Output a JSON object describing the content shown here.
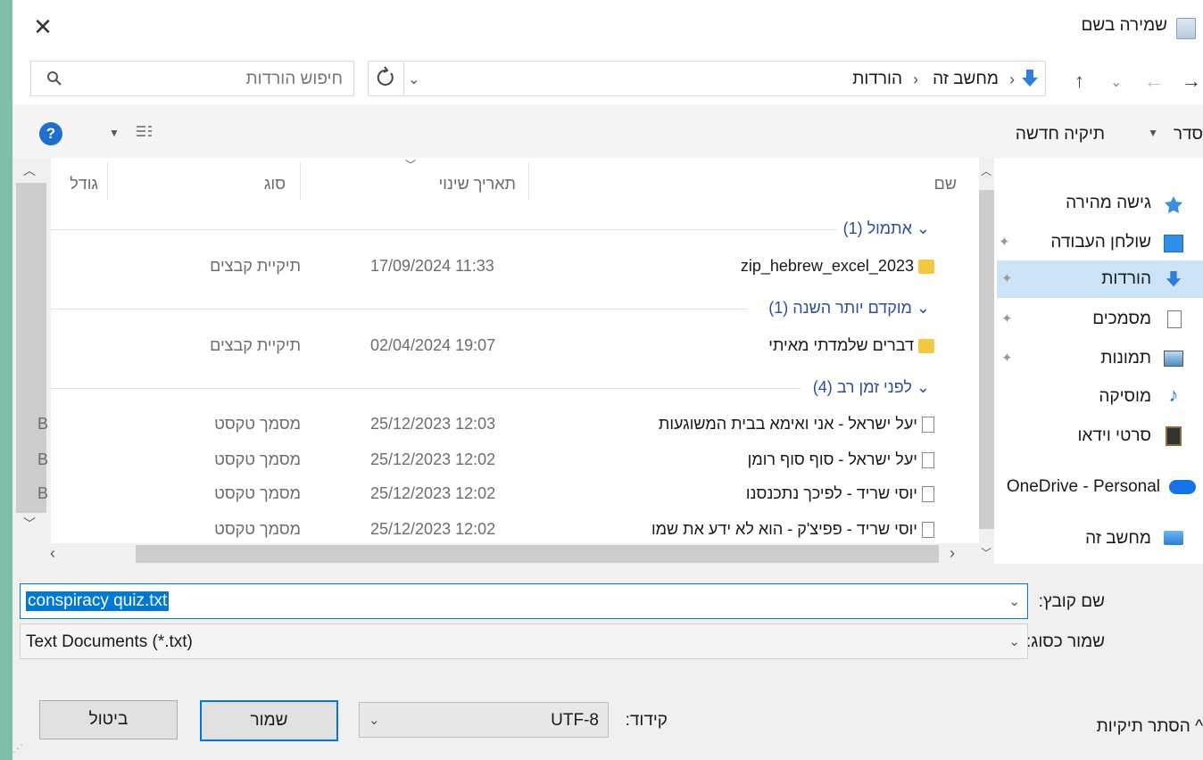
{
  "window": {
    "title": "שמירה בשם"
  },
  "nav": {
    "back": "←",
    "forward": "→",
    "recent": "⌄",
    "up": "↑",
    "breadcrumb": [
      "מחשב זה",
      "הורדות"
    ],
    "sep": "›",
    "search_placeholder": "חיפוש הורדות"
  },
  "toolbar": {
    "organize": "סדר",
    "new_folder": "תיקיה חדשה"
  },
  "sidebar": {
    "items": [
      {
        "label": "גישה מהירה",
        "icon": "star-icon"
      },
      {
        "label": "שולחן העבודה",
        "icon": "desktop-icon"
      },
      {
        "label": "הורדות",
        "icon": "download-icon"
      },
      {
        "label": "מסמכים",
        "icon": "documents-icon"
      },
      {
        "label": "תמונות",
        "icon": "pictures-icon"
      },
      {
        "label": "מוסיקה",
        "icon": "music-icon"
      },
      {
        "label": "סרטי וידאו",
        "icon": "video-icon"
      },
      {
        "label": "OneDrive - Personal",
        "icon": "cloud-icon"
      },
      {
        "label": "מחשב זה",
        "icon": "computer-icon"
      }
    ]
  },
  "columns": {
    "name": "שם",
    "date": "תאריך שינוי",
    "type": "סוג",
    "size": "גודל"
  },
  "groups": [
    {
      "label": "אתמול (1)",
      "rows": [
        {
          "name": "zip_hebrew_excel_2023",
          "date": "17/09/2024 11:33",
          "type": "תיקיית קבצים",
          "size": ""
        }
      ]
    },
    {
      "label": "מוקדם יותר השנה (1)",
      "rows": [
        {
          "name": "דברים שלמדתי מאיתי",
          "date": "02/04/2024 19:07",
          "type": "תיקיית קבצים",
          "size": ""
        }
      ]
    },
    {
      "label": "לפני זמן רב (4)",
      "rows": [
        {
          "name": "יעל ישראל - אני ואימא בבית המשוגעות",
          "date": "25/12/2023 12:03",
          "type": "מסמך טקסט",
          "size": "B"
        },
        {
          "name": "יעל ישראל - סוף סוף רומן",
          "date": "25/12/2023 12:02",
          "type": "מסמך טקסט",
          "size": "B"
        },
        {
          "name": "יוסי שריד - לפיכך נתכנסנו",
          "date": "25/12/2023 12:02",
          "type": "מסמך טקסט",
          "size": "B"
        },
        {
          "name": "יוסי שריד - פפיצ'ק - הוא לא ידע את שמו",
          "date": "25/12/2023 12:02",
          "type": "מסמך טקסט",
          "size": ""
        }
      ]
    }
  ],
  "form": {
    "filename_label": "שם קובץ:",
    "filename_value": "conspiracy quiz.txt",
    "savetype_label": "שמור כסוג:",
    "savetype_value": "Text Documents (*.txt)",
    "encoding_label": "קידוד:",
    "encoding_value": "UTF-8"
  },
  "buttons": {
    "save": "שמור",
    "cancel": "ביטול",
    "hide_folders": "הסתר תיקיות"
  },
  "colors": {
    "accent": "#0078d7",
    "group_text": "#2b4e9d",
    "selection": "#cce4f7"
  }
}
